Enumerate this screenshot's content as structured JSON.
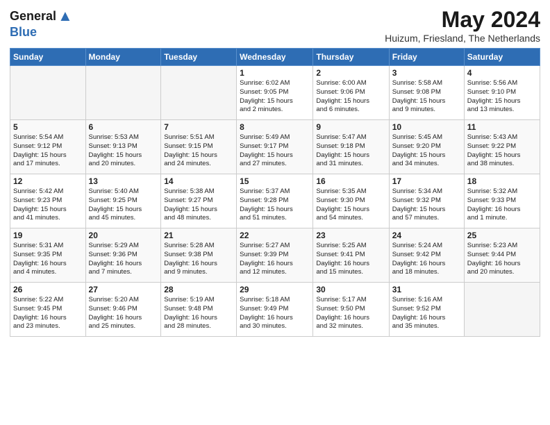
{
  "header": {
    "logo_general": "General",
    "logo_blue": "Blue",
    "month": "May 2024",
    "location": "Huizum, Friesland, The Netherlands"
  },
  "weekdays": [
    "Sunday",
    "Monday",
    "Tuesday",
    "Wednesday",
    "Thursday",
    "Friday",
    "Saturday"
  ],
  "weeks": [
    [
      {
        "day": "",
        "info": ""
      },
      {
        "day": "",
        "info": ""
      },
      {
        "day": "",
        "info": ""
      },
      {
        "day": "1",
        "info": "Sunrise: 6:02 AM\nSunset: 9:05 PM\nDaylight: 15 hours\nand 2 minutes."
      },
      {
        "day": "2",
        "info": "Sunrise: 6:00 AM\nSunset: 9:06 PM\nDaylight: 15 hours\nand 6 minutes."
      },
      {
        "day": "3",
        "info": "Sunrise: 5:58 AM\nSunset: 9:08 PM\nDaylight: 15 hours\nand 9 minutes."
      },
      {
        "day": "4",
        "info": "Sunrise: 5:56 AM\nSunset: 9:10 PM\nDaylight: 15 hours\nand 13 minutes."
      }
    ],
    [
      {
        "day": "5",
        "info": "Sunrise: 5:54 AM\nSunset: 9:12 PM\nDaylight: 15 hours\nand 17 minutes."
      },
      {
        "day": "6",
        "info": "Sunrise: 5:53 AM\nSunset: 9:13 PM\nDaylight: 15 hours\nand 20 minutes."
      },
      {
        "day": "7",
        "info": "Sunrise: 5:51 AM\nSunset: 9:15 PM\nDaylight: 15 hours\nand 24 minutes."
      },
      {
        "day": "8",
        "info": "Sunrise: 5:49 AM\nSunset: 9:17 PM\nDaylight: 15 hours\nand 27 minutes."
      },
      {
        "day": "9",
        "info": "Sunrise: 5:47 AM\nSunset: 9:18 PM\nDaylight: 15 hours\nand 31 minutes."
      },
      {
        "day": "10",
        "info": "Sunrise: 5:45 AM\nSunset: 9:20 PM\nDaylight: 15 hours\nand 34 minutes."
      },
      {
        "day": "11",
        "info": "Sunrise: 5:43 AM\nSunset: 9:22 PM\nDaylight: 15 hours\nand 38 minutes."
      }
    ],
    [
      {
        "day": "12",
        "info": "Sunrise: 5:42 AM\nSunset: 9:23 PM\nDaylight: 15 hours\nand 41 minutes."
      },
      {
        "day": "13",
        "info": "Sunrise: 5:40 AM\nSunset: 9:25 PM\nDaylight: 15 hours\nand 45 minutes."
      },
      {
        "day": "14",
        "info": "Sunrise: 5:38 AM\nSunset: 9:27 PM\nDaylight: 15 hours\nand 48 minutes."
      },
      {
        "day": "15",
        "info": "Sunrise: 5:37 AM\nSunset: 9:28 PM\nDaylight: 15 hours\nand 51 minutes."
      },
      {
        "day": "16",
        "info": "Sunrise: 5:35 AM\nSunset: 9:30 PM\nDaylight: 15 hours\nand 54 minutes."
      },
      {
        "day": "17",
        "info": "Sunrise: 5:34 AM\nSunset: 9:32 PM\nDaylight: 15 hours\nand 57 minutes."
      },
      {
        "day": "18",
        "info": "Sunrise: 5:32 AM\nSunset: 9:33 PM\nDaylight: 16 hours\nand 1 minute."
      }
    ],
    [
      {
        "day": "19",
        "info": "Sunrise: 5:31 AM\nSunset: 9:35 PM\nDaylight: 16 hours\nand 4 minutes."
      },
      {
        "day": "20",
        "info": "Sunrise: 5:29 AM\nSunset: 9:36 PM\nDaylight: 16 hours\nand 7 minutes."
      },
      {
        "day": "21",
        "info": "Sunrise: 5:28 AM\nSunset: 9:38 PM\nDaylight: 16 hours\nand 9 minutes."
      },
      {
        "day": "22",
        "info": "Sunrise: 5:27 AM\nSunset: 9:39 PM\nDaylight: 16 hours\nand 12 minutes."
      },
      {
        "day": "23",
        "info": "Sunrise: 5:25 AM\nSunset: 9:41 PM\nDaylight: 16 hours\nand 15 minutes."
      },
      {
        "day": "24",
        "info": "Sunrise: 5:24 AM\nSunset: 9:42 PM\nDaylight: 16 hours\nand 18 minutes."
      },
      {
        "day": "25",
        "info": "Sunrise: 5:23 AM\nSunset: 9:44 PM\nDaylight: 16 hours\nand 20 minutes."
      }
    ],
    [
      {
        "day": "26",
        "info": "Sunrise: 5:22 AM\nSunset: 9:45 PM\nDaylight: 16 hours\nand 23 minutes."
      },
      {
        "day": "27",
        "info": "Sunrise: 5:20 AM\nSunset: 9:46 PM\nDaylight: 16 hours\nand 25 minutes."
      },
      {
        "day": "28",
        "info": "Sunrise: 5:19 AM\nSunset: 9:48 PM\nDaylight: 16 hours\nand 28 minutes."
      },
      {
        "day": "29",
        "info": "Sunrise: 5:18 AM\nSunset: 9:49 PM\nDaylight: 16 hours\nand 30 minutes."
      },
      {
        "day": "30",
        "info": "Sunrise: 5:17 AM\nSunset: 9:50 PM\nDaylight: 16 hours\nand 32 minutes."
      },
      {
        "day": "31",
        "info": "Sunrise: 5:16 AM\nSunset: 9:52 PM\nDaylight: 16 hours\nand 35 minutes."
      },
      {
        "day": "",
        "info": ""
      }
    ]
  ]
}
